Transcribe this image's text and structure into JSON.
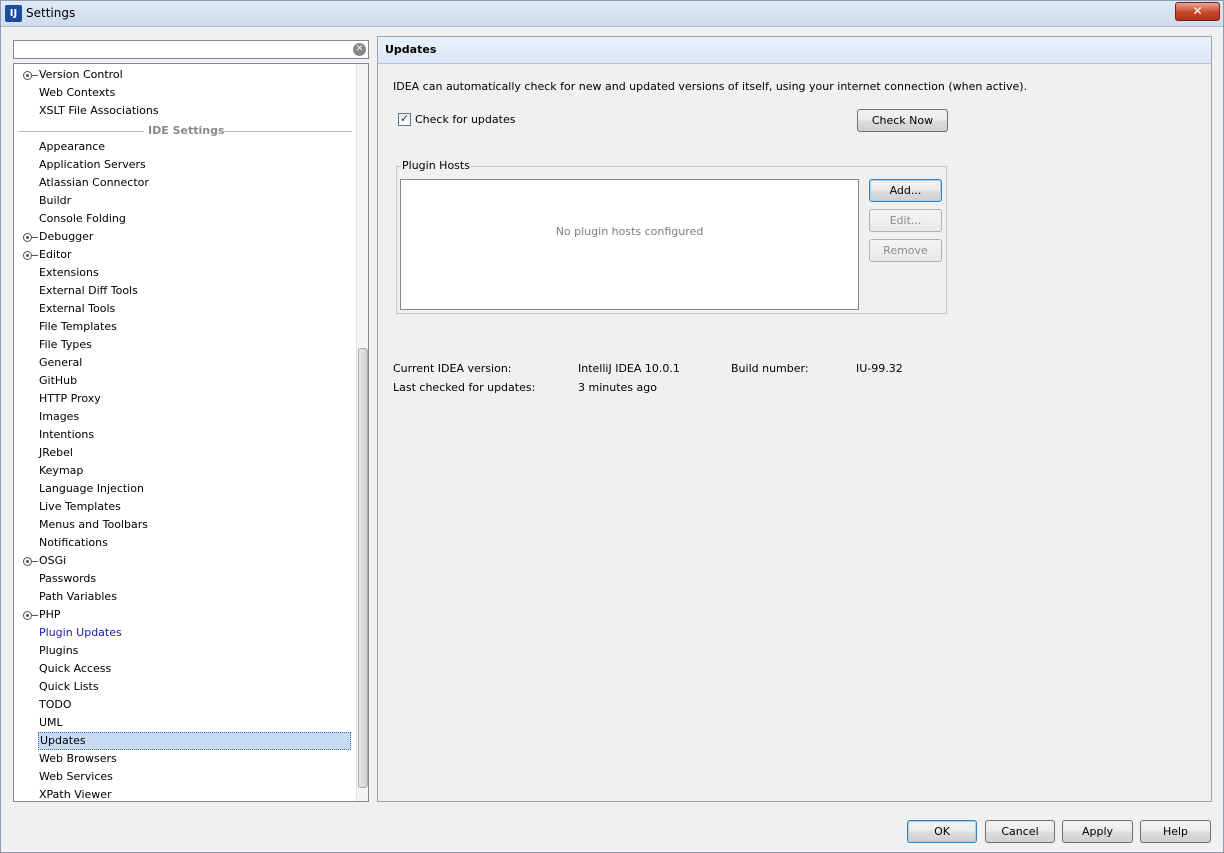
{
  "window": {
    "title": "Settings",
    "app_icon_text": "IJ",
    "close_label": "✕"
  },
  "search": {
    "value": "",
    "placeholder": ""
  },
  "tree": {
    "group_label": "IDE Settings",
    "project_items": [
      {
        "label": "Version Control",
        "expandable": true
      },
      {
        "label": "Web Contexts",
        "expandable": false
      },
      {
        "label": "XSLT File Associations",
        "expandable": false
      }
    ],
    "ide_items": [
      {
        "label": "Appearance",
        "expandable": false
      },
      {
        "label": "Application Servers",
        "expandable": false
      },
      {
        "label": "Atlassian Connector",
        "expandable": false
      },
      {
        "label": "Buildr",
        "expandable": false
      },
      {
        "label": "Console Folding",
        "expandable": false
      },
      {
        "label": "Debugger",
        "expandable": true
      },
      {
        "label": "Editor",
        "expandable": true
      },
      {
        "label": "Extensions",
        "expandable": false
      },
      {
        "label": "External Diff Tools",
        "expandable": false
      },
      {
        "label": "External Tools",
        "expandable": false
      },
      {
        "label": "File Templates",
        "expandable": false
      },
      {
        "label": "File Types",
        "expandable": false
      },
      {
        "label": "General",
        "expandable": false
      },
      {
        "label": "GitHub",
        "expandable": false
      },
      {
        "label": "HTTP Proxy",
        "expandable": false
      },
      {
        "label": "Images",
        "expandable": false
      },
      {
        "label": "Intentions",
        "expandable": false
      },
      {
        "label": "JRebel",
        "expandable": false
      },
      {
        "label": "Keymap",
        "expandable": false
      },
      {
        "label": "Language Injection",
        "expandable": false
      },
      {
        "label": "Live Templates",
        "expandable": false
      },
      {
        "label": "Menus and Toolbars",
        "expandable": false
      },
      {
        "label": "Notifications",
        "expandable": false
      },
      {
        "label": "OSGi",
        "expandable": true
      },
      {
        "label": "Passwords",
        "expandable": false
      },
      {
        "label": "Path Variables",
        "expandable": false
      },
      {
        "label": "PHP",
        "expandable": true
      },
      {
        "label": "Plugin Updates",
        "expandable": false,
        "link": true
      },
      {
        "label": "Plugins",
        "expandable": false
      },
      {
        "label": "Quick Access",
        "expandable": false
      },
      {
        "label": "Quick Lists",
        "expandable": false
      },
      {
        "label": "TODO",
        "expandable": false
      },
      {
        "label": "UML",
        "expandable": false
      },
      {
        "label": "Updates",
        "expandable": false,
        "selected": true
      },
      {
        "label": "Web Browsers",
        "expandable": false
      },
      {
        "label": "Web Services",
        "expandable": false
      },
      {
        "label": "XPath Viewer",
        "expandable": false
      }
    ]
  },
  "updates": {
    "title": "Updates",
    "description": "IDEA can automatically check for new and updated versions of itself, using your internet connection (when active).",
    "check_label": "Check for updates",
    "check_checked": true,
    "check_now_label": "Check  Now",
    "plugin_hosts_label": "Plugin Hosts",
    "no_hosts_text": "No plugin hosts configured",
    "add_label": "Add...",
    "edit_label": "Edit...",
    "remove_label": "Remove",
    "current_version_label": "Current IDEA version:",
    "current_version_value": "IntelliJ IDEA 10.0.1",
    "build_number_label": "Build number:",
    "build_number_value": "IU-99.32",
    "last_checked_label": "Last checked for updates:",
    "last_checked_value": "3 minutes ago"
  },
  "dialog_buttons": {
    "ok": "OK",
    "cancel": "Cancel",
    "apply": "Apply",
    "help": "Help"
  }
}
